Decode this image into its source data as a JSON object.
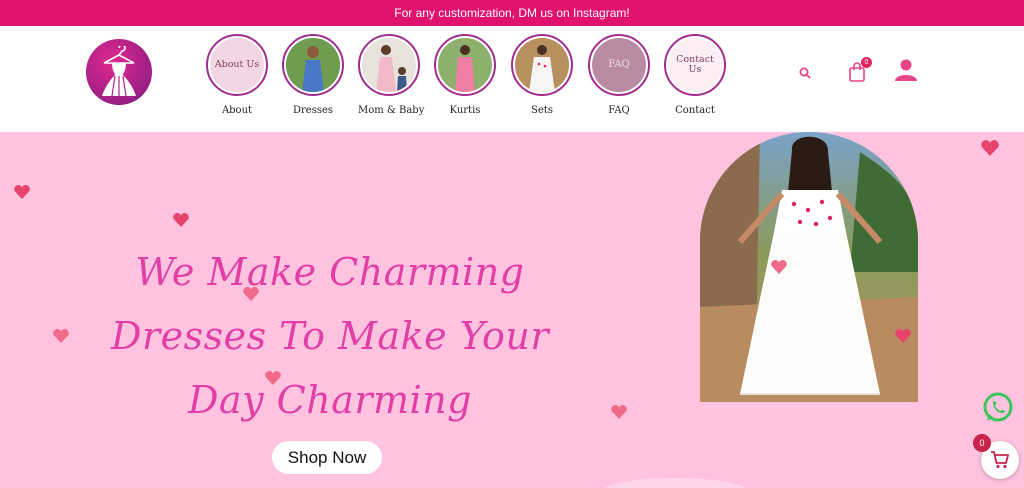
{
  "announcement": "For any customization, DM us on Instagram!",
  "brand": {
    "logo_icon": "dress-hanger-icon"
  },
  "nav": {
    "categories": [
      {
        "label": "About",
        "circle_text": "About Us"
      },
      {
        "label": "Dresses",
        "circle_text": ""
      },
      {
        "label": "Mom & Baby",
        "circle_text": ""
      },
      {
        "label": "Kurtis",
        "circle_text": ""
      },
      {
        "label": "Sets",
        "circle_text": ""
      },
      {
        "label": "FAQ",
        "circle_text": "FAQ"
      },
      {
        "label": "Contact",
        "circle_text": "Contact Us"
      }
    ]
  },
  "header_icons": {
    "search": "search-icon",
    "cart": "shopping-bag-icon",
    "cart_count": "0",
    "account": "user-icon"
  },
  "hero": {
    "title": "We Make Charming Dresses To Make Your Day Charming",
    "cta": "Shop Now"
  },
  "floating": {
    "whatsapp": "whatsapp-icon",
    "cart_count": "0"
  },
  "colors": {
    "topbar": "#e1126d",
    "hero_bg": "#ffc3df",
    "title": "#e23ea7",
    "accent": "#a12d8f",
    "heart": "#e8426f"
  }
}
